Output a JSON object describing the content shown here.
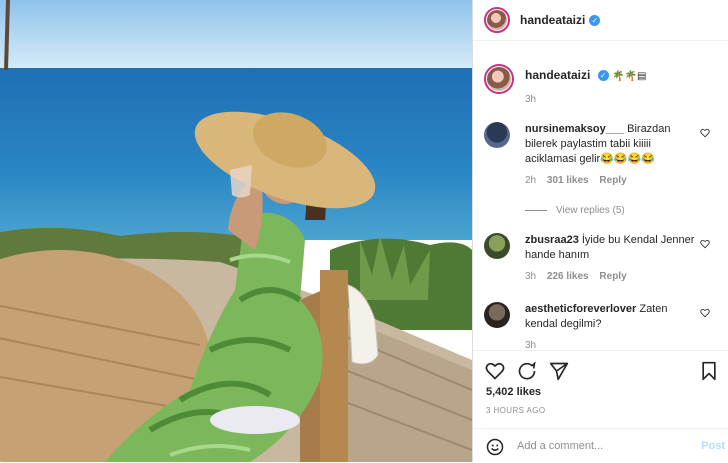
{
  "post": {
    "username": "handeataizi",
    "caption_emoji": "🌴🌴▤",
    "caption_time": "3h",
    "likes": "5,402 likes",
    "time_ago": "3 HOURS AGO"
  },
  "comments": [
    {
      "username": "nursinemaksoy___",
      "text": "Birazdan bilerek paylastim tabii kiiiii aciklamasi gelir😂😂😂😂",
      "time": "2h",
      "likes": "301 likes",
      "reply": "Reply"
    },
    {
      "username": "zbusraa23",
      "text": "İyide bu Kendal Jenner hande hanım",
      "time": "3h",
      "likes": "226 likes",
      "reply": "Reply"
    },
    {
      "username": "aestheticforeverlover",
      "text": "Zaten kendal degilmi?",
      "time": "3h",
      "likes": "",
      "reply": ""
    }
  ],
  "view_replies": "View replies (5)",
  "add_comment": {
    "placeholder": "Add a comment...",
    "post_label": "Post"
  },
  "icons": [
    "verified-badge-icon",
    "heart-icon",
    "comment-icon",
    "share-icon",
    "bookmark-icon",
    "smiley-icon"
  ],
  "colors": {
    "verified": "#3897f0",
    "post_disabled": "#b2dffc",
    "meta": "#8e8e8e"
  }
}
